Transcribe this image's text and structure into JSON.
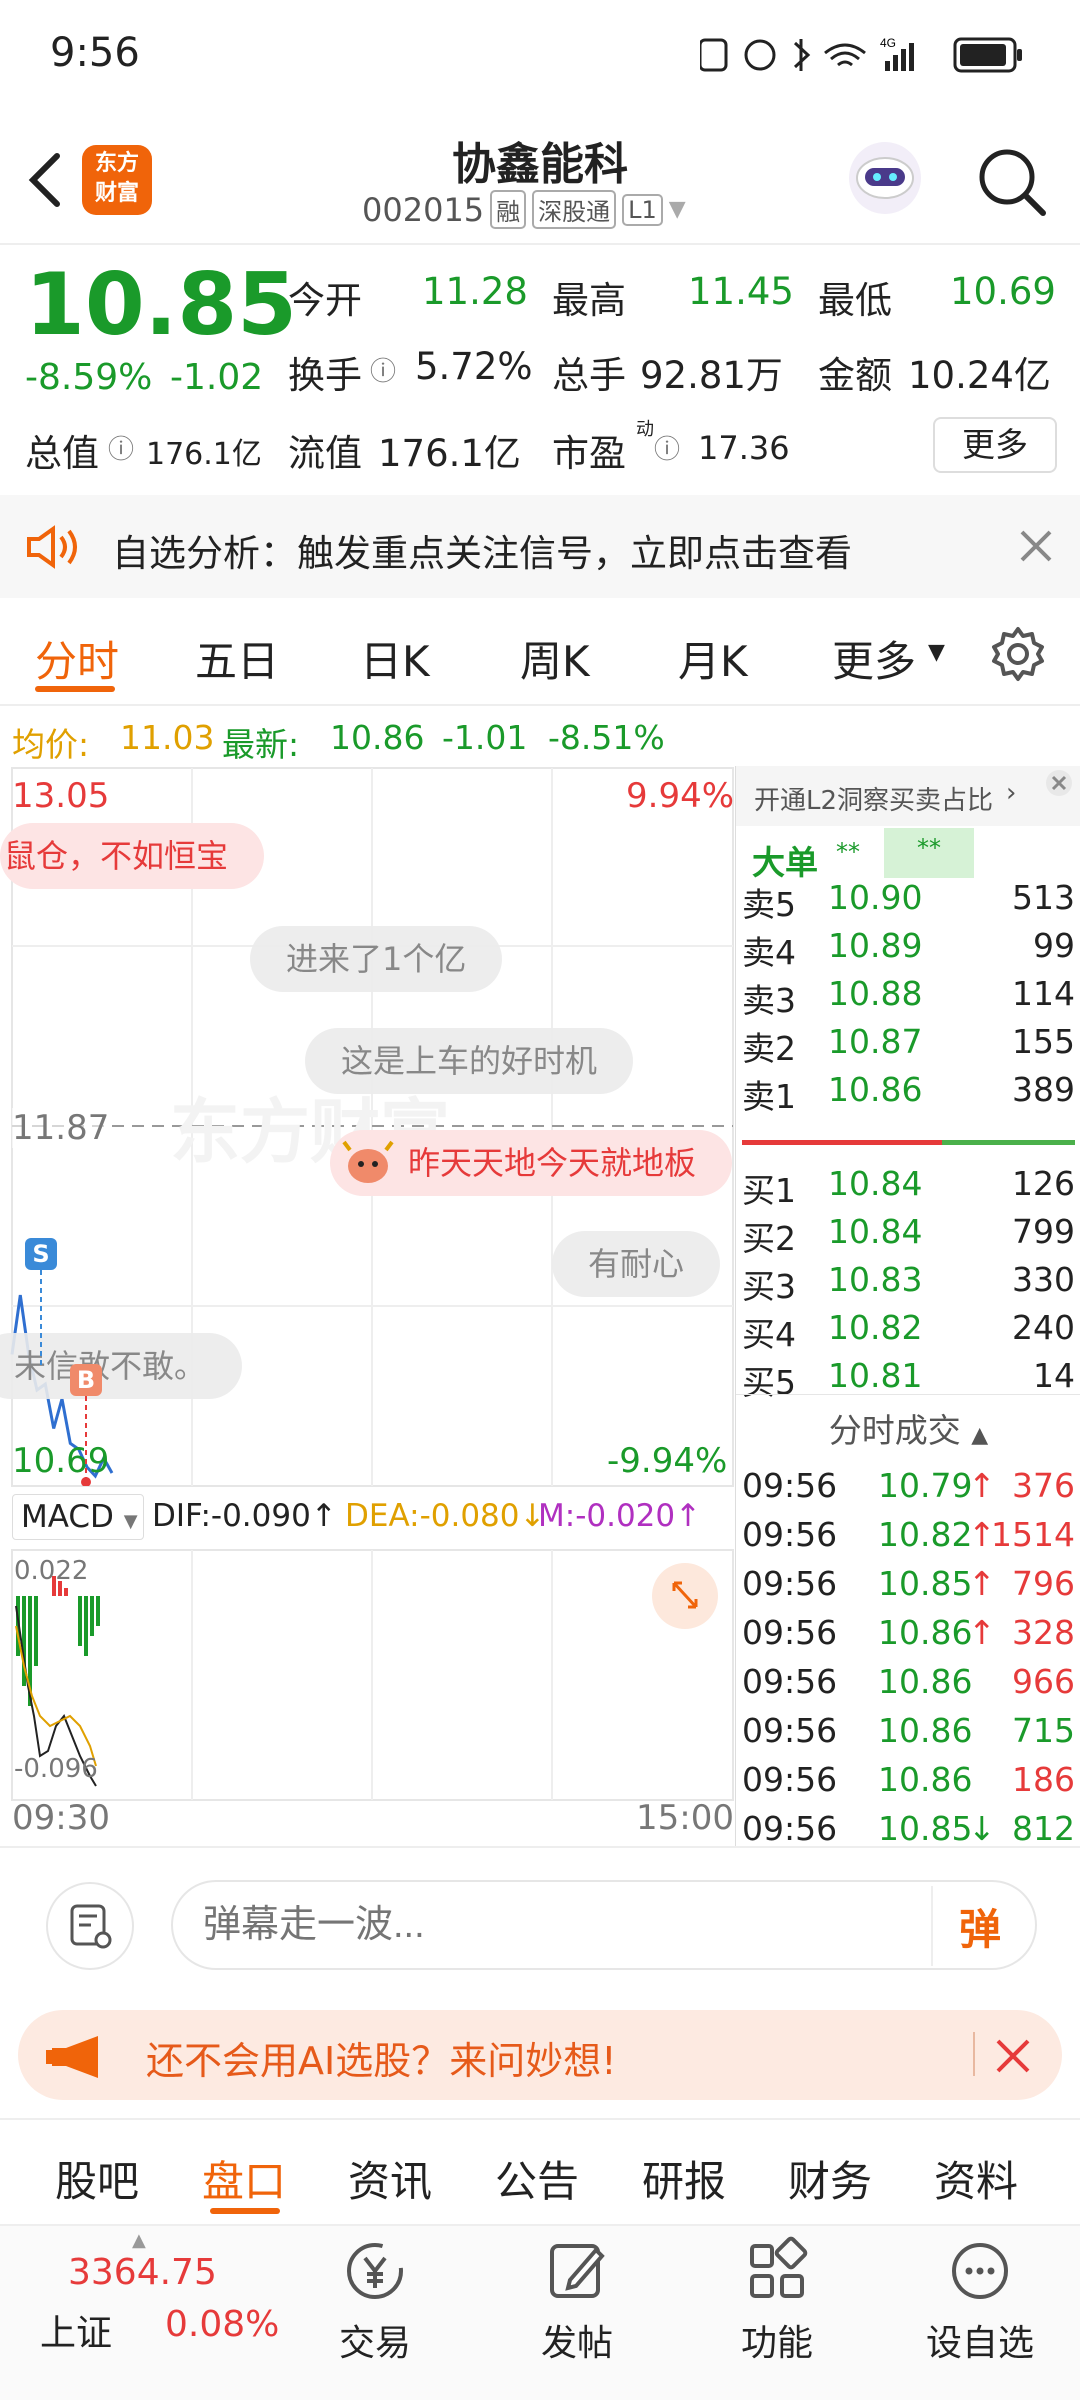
{
  "status_bar": {
    "time": "9:56",
    "network": "4G"
  },
  "header": {
    "title": "协鑫能科",
    "code": "002015",
    "badges": [
      "融",
      "深股通",
      "L1"
    ],
    "logo_text": "东方财富"
  },
  "quote": {
    "price": "10.85",
    "change_pct": "-8.59%",
    "change": "-1.02",
    "fields": [
      {
        "label": "今开",
        "value": "11.28"
      },
      {
        "label": "最高",
        "value": "11.45"
      },
      {
        "label": "最低",
        "value": "10.69"
      },
      {
        "label": "换手",
        "value": "5.72%"
      },
      {
        "label": "总手",
        "value": "92.81万"
      },
      {
        "label": "金额",
        "value": "10.24亿"
      },
      {
        "label": "总值",
        "value": "176.1亿"
      },
      {
        "label": "流值",
        "value": "176.1亿"
      },
      {
        "label": "市盈",
        "value": "17.36"
      }
    ],
    "pe_sup": "动",
    "more_label": "更多"
  },
  "banner": {
    "text": "自选分析：触发重点关注信号，立即点击查看"
  },
  "tabs": [
    {
      "label": "分时",
      "active": true
    },
    {
      "label": "五日"
    },
    {
      "label": "日K"
    },
    {
      "label": "周K"
    },
    {
      "label": "月K"
    },
    {
      "label": "更多"
    }
  ],
  "avg_line": {
    "avg_label": "均价:",
    "avg_value": "11.03",
    "latest_label": "最新:",
    "latest_value": "10.86",
    "latest_change": "-1.01",
    "latest_pct": "-8.51%"
  },
  "chart": {
    "top_price": "13.05",
    "top_pct": "9.94%",
    "mid_price": "11.87",
    "bottom_price": "10.69",
    "bottom_pct": "-9.94%",
    "start_time": "09:30",
    "end_time": "15:00",
    "bubbles": [
      "鼠仓，不如恒宝",
      "进来了1个亿",
      "这是上车的好时机",
      "昨天天地今天就地板",
      "有耐心",
      "未信敢不敢。"
    ],
    "markers": [
      "S",
      "B"
    ],
    "macd": {
      "label": "MACD",
      "dif": "DIF:-0.090",
      "dea": "DEA:-0.080",
      "m": "M:-0.020",
      "top": "0.022",
      "bottom": "-0.096"
    }
  },
  "chart_data": {
    "type": "line",
    "series": [
      {
        "values": [
          11.1,
          11.3,
          11.1,
          10.98,
          11.0,
          10.85,
          10.95,
          10.8,
          10.78,
          10.72,
          10.69,
          10.75,
          10.7
        ]
      }
    ],
    "x_range": [
      "09:30",
      "15:00"
    ],
    "ylim": [
      10.69,
      13.05
    ]
  },
  "order_book": {
    "l2_text": "开通L2洞察买卖占比",
    "big_order": "大单",
    "masked": "**",
    "asks": [
      {
        "label": "卖5",
        "price": "10.90",
        "vol": "513"
      },
      {
        "label": "卖4",
        "price": "10.89",
        "vol": "99"
      },
      {
        "label": "卖3",
        "price": "10.88",
        "vol": "114"
      },
      {
        "label": "卖2",
        "price": "10.87",
        "vol": "155"
      },
      {
        "label": "卖1",
        "price": "10.86",
        "vol": "389"
      }
    ],
    "bids": [
      {
        "label": "买1",
        "price": "10.84",
        "vol": "126"
      },
      {
        "label": "买2",
        "price": "10.84",
        "vol": "799"
      },
      {
        "label": "买3",
        "price": "10.83",
        "vol": "330"
      },
      {
        "label": "买4",
        "price": "10.82",
        "vol": "240"
      },
      {
        "label": "买5",
        "price": "10.81",
        "vol": "14"
      }
    ],
    "trades_title": "分时成交",
    "trades": [
      {
        "time": "09:56",
        "price": "10.79",
        "arrow": "↑",
        "vol": "376",
        "vcolor": "#e63a3a"
      },
      {
        "time": "09:56",
        "price": "10.82",
        "arrow": "↑",
        "vol": "1514",
        "vcolor": "#e63a3a"
      },
      {
        "time": "09:56",
        "price": "10.85",
        "arrow": "↑",
        "vol": "796",
        "vcolor": "#e63a3a"
      },
      {
        "time": "09:56",
        "price": "10.86",
        "arrow": "↑",
        "vol": "328",
        "vcolor": "#e63a3a"
      },
      {
        "time": "09:56",
        "price": "10.86",
        "arrow": "",
        "vol": "966",
        "vcolor": "#e63a3a"
      },
      {
        "time": "09:56",
        "price": "10.86",
        "arrow": "",
        "vol": "715",
        "vcolor": "#1a9a2a"
      },
      {
        "time": "09:56",
        "price": "10.86",
        "arrow": "",
        "vol": "186",
        "vcolor": "#e63a3a"
      },
      {
        "time": "09:56",
        "price": "10.85",
        "arrow": "↓",
        "vol": "812",
        "vcolor": "#1a9a2a"
      }
    ]
  },
  "danmu": {
    "placeholder": "弹幕走一波...",
    "send_label": "弹"
  },
  "ai_banner": {
    "text": "还不会用AI选股？来问妙想!"
  },
  "sub_tabs": [
    {
      "label": "股吧"
    },
    {
      "label": "盘口",
      "active": true
    },
    {
      "label": "资讯"
    },
    {
      "label": "公告"
    },
    {
      "label": "研报"
    },
    {
      "label": "财务"
    },
    {
      "label": "资料"
    }
  ],
  "bottom_bar": {
    "index_value": "3364.75",
    "index_name": "上证",
    "index_pct": "0.08%",
    "items": [
      {
        "label": "交易",
        "icon": "yen-icon"
      },
      {
        "label": "发帖",
        "icon": "edit-icon"
      },
      {
        "label": "功能",
        "icon": "grid-icon"
      },
      {
        "label": "设自选",
        "icon": "more-icon"
      }
    ]
  },
  "colors": {
    "up": "#e63a3a",
    "down": "#1a9a2a",
    "accent": "#f0640a"
  }
}
